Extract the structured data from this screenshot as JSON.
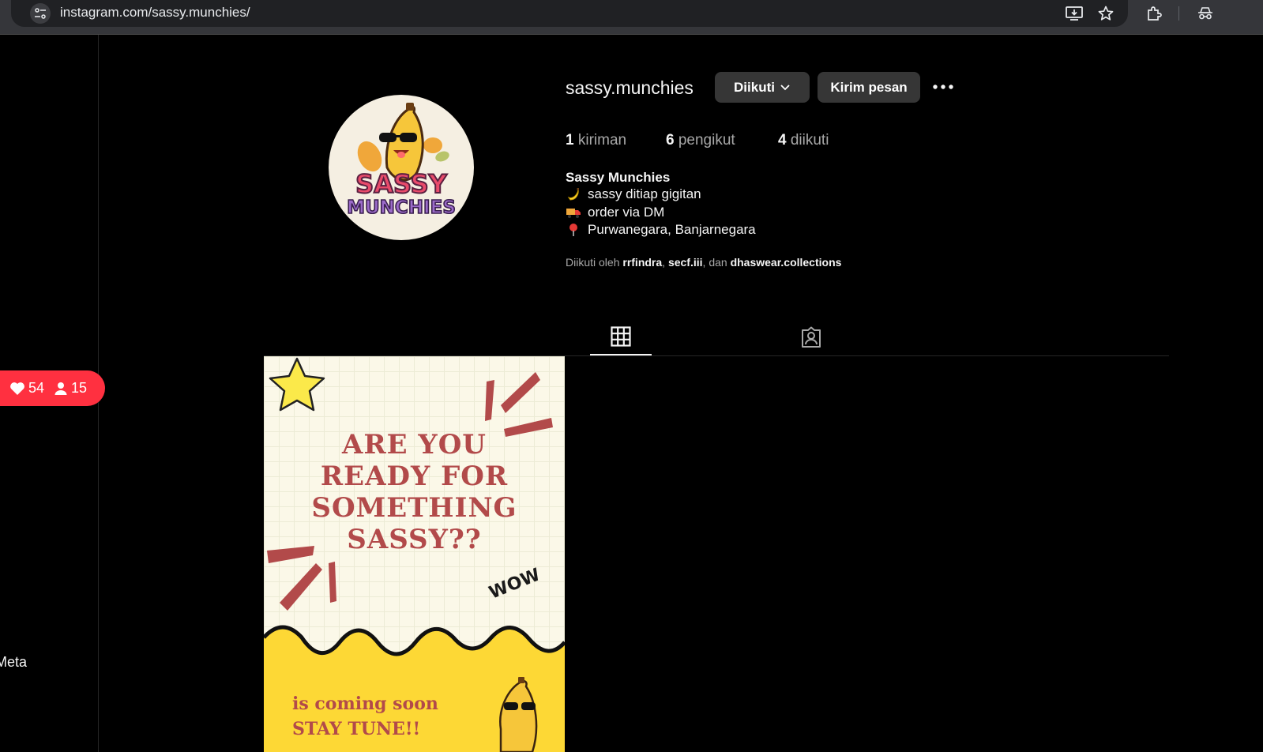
{
  "browser": {
    "url": "instagram.com/sassy.munchies/",
    "icons": [
      "site-info-icon",
      "install-app-icon",
      "bookmark-star-icon",
      "extensions-icon",
      "incognito-icon"
    ]
  },
  "sidebar": {
    "notification": {
      "likes": "54",
      "followers": "15"
    },
    "footer_text": "Meta"
  },
  "profile": {
    "username": "sassy.munchies",
    "following_button": "Diikuti",
    "message_button": "Kirim pesan",
    "stats": {
      "posts_count": "1",
      "posts_label": "kiriman",
      "followers_count": "6",
      "followers_label": "pengikut",
      "following_count": "4",
      "following_label": "diikuti"
    },
    "bio": {
      "name": "Sassy Munchies",
      "line1": "sassy ditiap gigitan",
      "line2": "order via DM",
      "line3": "Purwanegara, Banjarnegara"
    },
    "followed_by": {
      "prefix": "Diikuti oleh",
      "user1": "rrfindra",
      "user2": "secf.iii",
      "conj": ", dan",
      "user3": "dhaswear.collections"
    },
    "avatar_text": {
      "line1": "SASSY",
      "line2": "MUNCHIES"
    }
  },
  "tabs": [
    {
      "name": "posts",
      "icon": "grid-icon",
      "active": true
    },
    {
      "name": "tagged",
      "icon": "tagged-user-icon",
      "active": false
    }
  ],
  "post": {
    "headline": [
      "ARE YOU",
      "READY FOR",
      "SOMETHING",
      "SASSY??"
    ],
    "badge": "WOW",
    "subline1": "is coming soon",
    "subline2": "STAY TUNE!!"
  },
  "colors": {
    "notification": "#ff3040",
    "button": "#363636",
    "post_text": "#b24a4a",
    "post_yellow": "#fdd835"
  }
}
